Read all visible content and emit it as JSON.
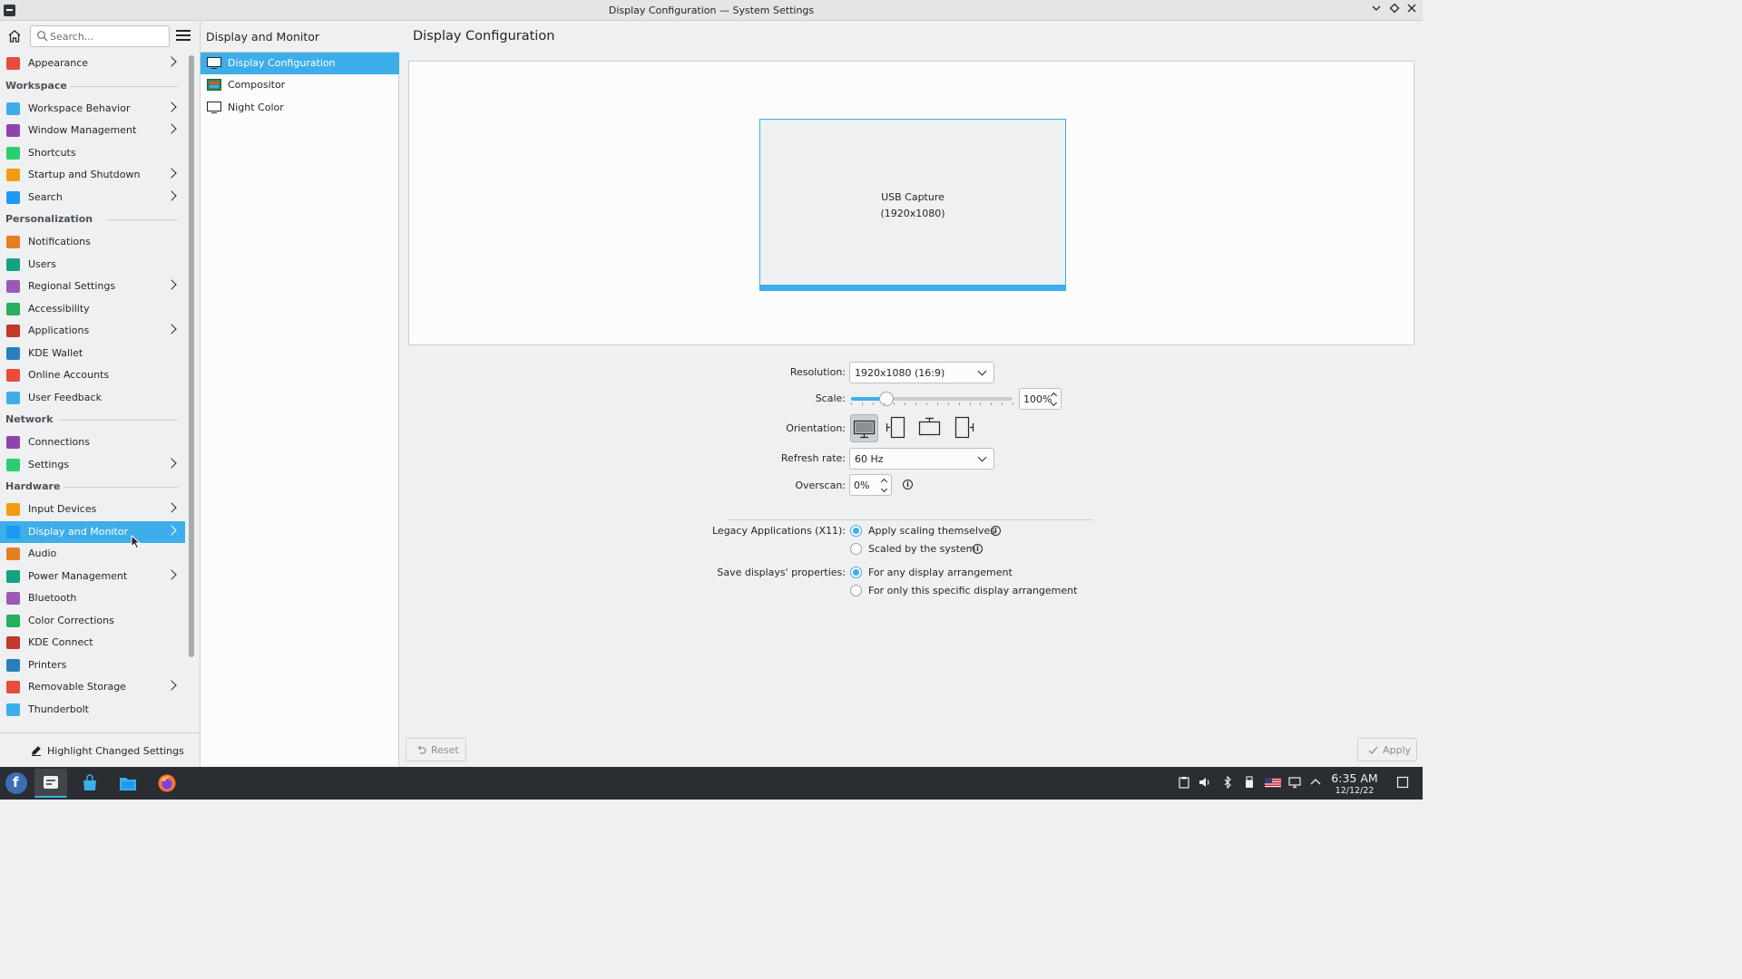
{
  "window": {
    "title": "Display Configuration — System Settings"
  },
  "sidebar": {
    "search_placeholder": "Search...",
    "items": [
      {
        "label": "Appearance",
        "icon": "appearance-icon",
        "chevron": true
      },
      {
        "heading": "Workspace"
      },
      {
        "label": "Workspace Behavior",
        "icon": "workspace-behavior-icon",
        "chevron": true
      },
      {
        "label": "Window Management",
        "icon": "window-management-icon",
        "chevron": true
      },
      {
        "label": "Shortcuts",
        "icon": "keyboard-icon",
        "chevron": false
      },
      {
        "label": "Startup and Shutdown",
        "icon": "startup-icon",
        "chevron": true
      },
      {
        "label": "Search",
        "icon": "search-icon",
        "chevron": true
      },
      {
        "heading": "Personalization"
      },
      {
        "label": "Notifications",
        "icon": "bell-icon",
        "chevron": false
      },
      {
        "label": "Users",
        "icon": "users-icon",
        "chevron": false
      },
      {
        "label": "Regional Settings",
        "icon": "regional-icon",
        "chevron": true
      },
      {
        "label": "Accessibility",
        "icon": "accessibility-icon",
        "chevron": false
      },
      {
        "label": "Applications",
        "icon": "applications-icon",
        "chevron": true
      },
      {
        "label": "KDE Wallet",
        "icon": "wallet-icon",
        "chevron": false
      },
      {
        "label": "Online Accounts",
        "icon": "online-accounts-icon",
        "chevron": false
      },
      {
        "label": "User Feedback",
        "icon": "feedback-icon",
        "chevron": false
      },
      {
        "heading": "Network"
      },
      {
        "label": "Connections",
        "icon": "globe-icon",
        "chevron": false
      },
      {
        "label": "Settings",
        "icon": "network-settings-icon",
        "chevron": true
      },
      {
        "heading": "Hardware"
      },
      {
        "label": "Input Devices",
        "icon": "mouse-icon",
        "chevron": true
      },
      {
        "label": "Display and Monitor",
        "icon": "monitor-icon",
        "chevron": true,
        "selected": true
      },
      {
        "label": "Audio",
        "icon": "audio-icon",
        "chevron": false
      },
      {
        "label": "Power Management",
        "icon": "power-icon",
        "chevron": true
      },
      {
        "label": "Bluetooth",
        "icon": "bluetooth-icon",
        "chevron": false
      },
      {
        "label": "Color Corrections",
        "icon": "color-icon",
        "chevron": false
      },
      {
        "label": "KDE Connect",
        "icon": "phone-icon",
        "chevron": false
      },
      {
        "label": "Printers",
        "icon": "printer-icon",
        "chevron": false
      },
      {
        "label": "Removable Storage",
        "icon": "usb-icon",
        "chevron": true
      },
      {
        "label": "Thunderbolt",
        "icon": "thunderbolt-icon",
        "chevron": false
      }
    ],
    "highlight_label": "Highlight Changed Settings"
  },
  "subpanel": {
    "title": "Display and Monitor",
    "items": [
      {
        "label": "Display Configuration",
        "selected": true
      },
      {
        "label": "Compositor",
        "selected": false
      },
      {
        "label": "Night Color",
        "selected": false
      }
    ]
  },
  "content": {
    "title": "Display Configuration",
    "monitor": {
      "name": "USB Capture",
      "resolution": "(1920x1080)"
    },
    "form": {
      "resolution_label": "Resolution:",
      "resolution_value": "1920x1080 (16:9)",
      "scale_label": "Scale:",
      "scale_value": "100%",
      "scale_fraction": 0.22,
      "orientation_label": "Orientation:",
      "orientation_selected": "normal",
      "refresh_label": "Refresh rate:",
      "refresh_value": "60 Hz",
      "overscan_label": "Overscan:",
      "overscan_value": "0%",
      "legacy_label": "Legacy Applications (X11):",
      "legacy_options": [
        "Apply scaling themselves",
        "Scaled by the system"
      ],
      "legacy_selected": 0,
      "save_label": "Save displays' properties:",
      "save_options": [
        "For any display arrangement",
        "For only this specific display arrangement"
      ],
      "save_selected": 0
    },
    "reset_label": "Reset",
    "apply_label": "Apply"
  },
  "taskbar": {
    "time": "6:35 AM",
    "date": "12/12/22"
  },
  "colors": {
    "accent": "#3daee9",
    "window_bg": "#eff0f1",
    "view_bg": "#fcfcfc",
    "taskbar_bg": "#2a2e32"
  }
}
